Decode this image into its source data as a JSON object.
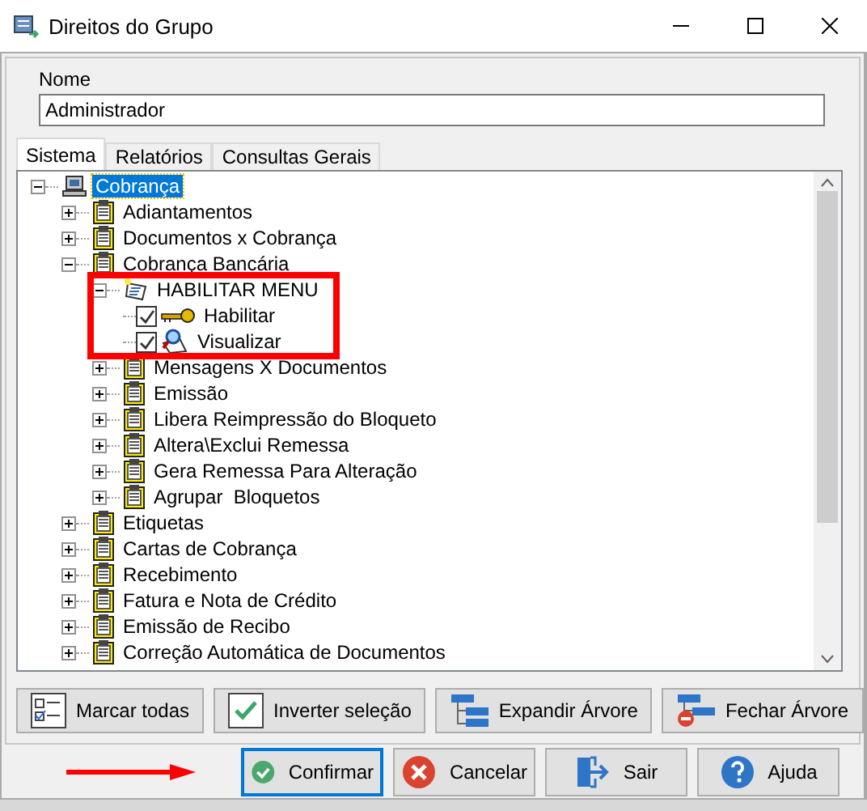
{
  "window": {
    "title": "Direitos do Grupo"
  },
  "name_field": {
    "label": "Nome",
    "value": "Administrador"
  },
  "tabs": [
    {
      "label": "Sistema",
      "selected": true
    },
    {
      "label": "Relatórios",
      "selected": false
    },
    {
      "label": "Consultas Gerais",
      "selected": false
    }
  ],
  "tree": [
    {
      "label": "Cobrança",
      "kind": "computer",
      "expanded": true,
      "selected": true,
      "children": [
        {
          "label": "Adiantamentos",
          "kind": "clipboard",
          "expanded": false,
          "selected": false
        },
        {
          "label": "Documentos x Cobrança",
          "kind": "clipboard",
          "expanded": false,
          "selected": false
        },
        {
          "label": "Cobrança Bancária",
          "kind": "clipboard",
          "expanded": true,
          "selected": false,
          "children": [
            {
              "label": "HABILITAR MENU",
              "kind": "menu",
              "expanded": true,
              "selected": false,
              "highlighted": true,
              "children": [
                {
                  "label": "Habilitar",
                  "kind": "key",
                  "checked": true,
                  "selected": false
                },
                {
                  "label": "Visualizar",
                  "kind": "magnifier",
                  "checked": true,
                  "selected": false
                }
              ]
            },
            {
              "label": "Mensagens X Documentos",
              "kind": "clipboard",
              "expanded": false,
              "selected": false
            },
            {
              "label": "Emissão",
              "kind": "clipboard",
              "expanded": false,
              "selected": false
            },
            {
              "label": "Libera Reimpressão do Bloqueto",
              "kind": "clipboard",
              "expanded": false,
              "selected": false
            },
            {
              "label": "Altera\\Exclui Remessa",
              "kind": "clipboard",
              "expanded": false,
              "selected": false
            },
            {
              "label": "Gera Remessa Para Alteração",
              "kind": "clipboard",
              "expanded": false,
              "selected": false
            },
            {
              "label": "Agrupar  Bloquetos",
              "kind": "clipboard",
              "expanded": false,
              "selected": false
            }
          ]
        },
        {
          "label": "Etiquetas",
          "kind": "clipboard",
          "expanded": false,
          "selected": false
        },
        {
          "label": "Cartas de Cobrança",
          "kind": "clipboard",
          "expanded": false,
          "selected": false
        },
        {
          "label": "Recebimento",
          "kind": "clipboard",
          "expanded": false,
          "selected": false
        },
        {
          "label": "Fatura e Nota de Crédito",
          "kind": "clipboard",
          "expanded": false,
          "selected": false
        },
        {
          "label": "Emissão de Recibo",
          "kind": "clipboard",
          "expanded": false,
          "selected": false
        },
        {
          "label": "Correção Automática de Documentos",
          "kind": "clipboard",
          "expanded": false,
          "selected": false
        }
      ]
    }
  ],
  "tree_buttons": [
    {
      "label": "Marcar todas",
      "kind": "checklist"
    },
    {
      "label": "Inverter seleção",
      "kind": "check"
    },
    {
      "label": "Expandir Árvore",
      "kind": "expand"
    },
    {
      "label": "Fechar Árvore",
      "kind": "collapse"
    }
  ],
  "dialog_buttons": [
    {
      "label": "Confirmar",
      "kind": "confirm",
      "selected": true
    },
    {
      "label": "Cancelar",
      "kind": "cancel",
      "selected": false
    },
    {
      "label": "Sair",
      "kind": "exit",
      "selected": false
    },
    {
      "label": "Ajuda",
      "kind": "help",
      "selected": false
    }
  ]
}
